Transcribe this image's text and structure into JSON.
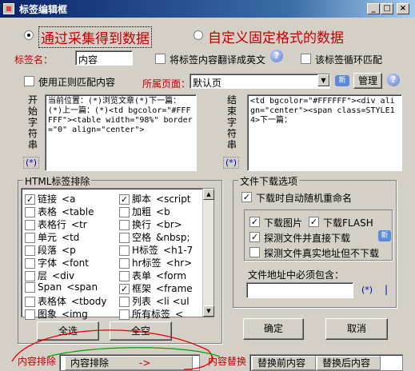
{
  "window": {
    "title": "标签编辑框"
  },
  "mode": {
    "option1": "通过采集得到数据",
    "option2": "自定义固定格式的数据"
  },
  "tag": {
    "name_label": "标签名：",
    "name_value": "内容",
    "translate_label": "将标签内容翻译成英文",
    "loop_label": "该标签循环匹配"
  },
  "regex": {
    "label": "使用正则匹配内容"
  },
  "page": {
    "label": "所属页面：",
    "selected": "默认页",
    "new_label": "新",
    "manage_button": "管理"
  },
  "start": {
    "label_chars": [
      "开",
      "始",
      "字",
      "符",
      "串"
    ],
    "value": "当前位置：(*)浏览文章(*)下一篇：(*)上一篇：(*)<td bgcolor=\"#FFFFFF\"><table width=\"98%\" border=\"0\" align=\"center\">",
    "wildcard": "(*)"
  },
  "end": {
    "label_chars": [
      "结",
      "束",
      "字",
      "符",
      "串"
    ],
    "value": "<td bgcolor=\"#FFFFFF\"><div align=\"center\"><span class=STYLE14>下一篇：",
    "wildcard": "(*)"
  },
  "html_exclude": {
    "title": "HTML标签排除",
    "left_col": [
      {
        "label": "链接",
        "code": "<a",
        "checked": true
      },
      {
        "label": "表格",
        "code": "<table",
        "checked": false
      },
      {
        "label": "表格行",
        "code": "<tr",
        "checked": false
      },
      {
        "label": "单元",
        "code": "<td",
        "checked": false
      },
      {
        "label": "段落",
        "code": "<p",
        "checked": false
      },
      {
        "label": "字体",
        "code": "<font",
        "checked": false
      },
      {
        "label": "层",
        "code": "<div",
        "checked": false
      },
      {
        "label": "Span",
        "code": "<span",
        "checked": false
      },
      {
        "label": "表格体",
        "code": "<tbody",
        "checked": false
      },
      {
        "label": "图象",
        "code": "<img",
        "checked": false
      }
    ],
    "right_col": [
      {
        "label": "脚本",
        "code": "<script",
        "checked": true
      },
      {
        "label": "加粗",
        "code": "<b",
        "checked": false
      },
      {
        "label": "换行",
        "code": "<br>",
        "checked": false
      },
      {
        "label": "空格",
        "code": "&nbsp;",
        "checked": false
      },
      {
        "label": "H标签",
        "code": "<h1-7",
        "checked": false
      },
      {
        "label": "hr标签",
        "code": "<hr>",
        "checked": false
      },
      {
        "label": "表单",
        "code": "<form",
        "checked": false
      },
      {
        "label": "框架",
        "code": "<frame",
        "checked": true
      },
      {
        "label": "列表",
        "code": "<li <ul",
        "checked": false
      },
      {
        "label": "所有标签",
        "code": "<",
        "checked": false
      }
    ],
    "select_all": "全选",
    "select_none": "全空"
  },
  "download": {
    "title": "文件下载选项",
    "rename_label": "下载时自动随机重命名",
    "images_label": "下载图片",
    "flash_label": "下载FLASH",
    "detect_label": "探测文件并直接下载",
    "real_addr_label": "探测文件真实地址但不下载",
    "must_contain_label": "文件地址中必须包含：",
    "must_contain_value": "",
    "wildcard": "(*)",
    "cursor": "|",
    "new_label": "新"
  },
  "actions": {
    "ok": "确定",
    "cancel": "取消"
  },
  "content_exclude": {
    "label": "内容排除",
    "column": "内容排除",
    "arrow": "->"
  },
  "content_replace": {
    "label": "内容替换",
    "col_before": "替换前内容",
    "col_after": "替换后内容"
  }
}
